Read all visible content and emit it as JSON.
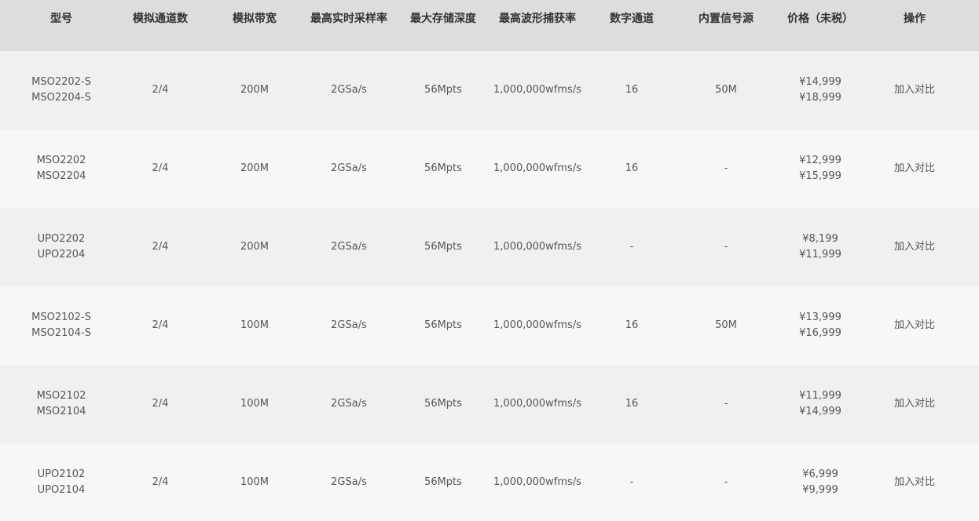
{
  "headers": [
    "型号",
    "模拟通道数",
    "模拟带宽",
    "最高实时采样率",
    "最大存储深度",
    "最高波形捕获率",
    "数字通道",
    "内置信号源",
    "价格（未税）",
    "操作"
  ],
  "rows": [
    {
      "model": [
        "MSO2202-S",
        "MSO2204-S"
      ],
      "channels": "2/4",
      "bandwidth": "200M",
      "sample_rate": "2GSa/s",
      "memory": "56Mpts",
      "capture_rate": "1,000,000wfms/s",
      "digital": "16",
      "source": "50M",
      "price": [
        "¥14,999",
        "¥18,999"
      ],
      "action": "加入对比"
    },
    {
      "model": [
        "MSO2202",
        "MSO2204"
      ],
      "channels": "2/4",
      "bandwidth": "200M",
      "sample_rate": "2GSa/s",
      "memory": "56Mpts",
      "capture_rate": "1,000,000wfms/s",
      "digital": "16",
      "source": "-",
      "price": [
        "¥12,999",
        "¥15,999"
      ],
      "action": "加入对比"
    },
    {
      "model": [
        "UPO2202",
        "UPO2204"
      ],
      "channels": "2/4",
      "bandwidth": "200M",
      "sample_rate": "2GSa/s",
      "memory": "56Mpts",
      "capture_rate": "1,000,000wfms/s",
      "digital": "-",
      "source": "-",
      "price": [
        "¥8,199",
        "¥11,999"
      ],
      "action": "加入对比"
    },
    {
      "model": [
        "MSO2102-S",
        "MSO2104-S"
      ],
      "channels": "2/4",
      "bandwidth": "100M",
      "sample_rate": "2GSa/s",
      "memory": "56Mpts",
      "capture_rate": "1,000,000wfms/s",
      "digital": "16",
      "source": "50M",
      "price": [
        "¥13,999",
        "¥16,999"
      ],
      "action": "加入对比"
    },
    {
      "model": [
        "MSO2102",
        "MSO2104"
      ],
      "channels": "2/4",
      "bandwidth": "100M",
      "sample_rate": "2GSa/s",
      "memory": "56Mpts",
      "capture_rate": "1,000,000wfms/s",
      "digital": "16",
      "source": "-",
      "price": [
        "¥11,999",
        "¥14,999"
      ],
      "action": "加入对比"
    },
    {
      "model": [
        "UPO2102",
        "UPO2104"
      ],
      "channels": "2/4",
      "bandwidth": "100M",
      "sample_rate": "2GSa/s",
      "memory": "56Mpts",
      "capture_rate": "1,000,000wfms/s",
      "digital": "-",
      "source": "-",
      "price": [
        "¥6,999",
        "¥9,999"
      ],
      "action": "加入对比"
    }
  ]
}
